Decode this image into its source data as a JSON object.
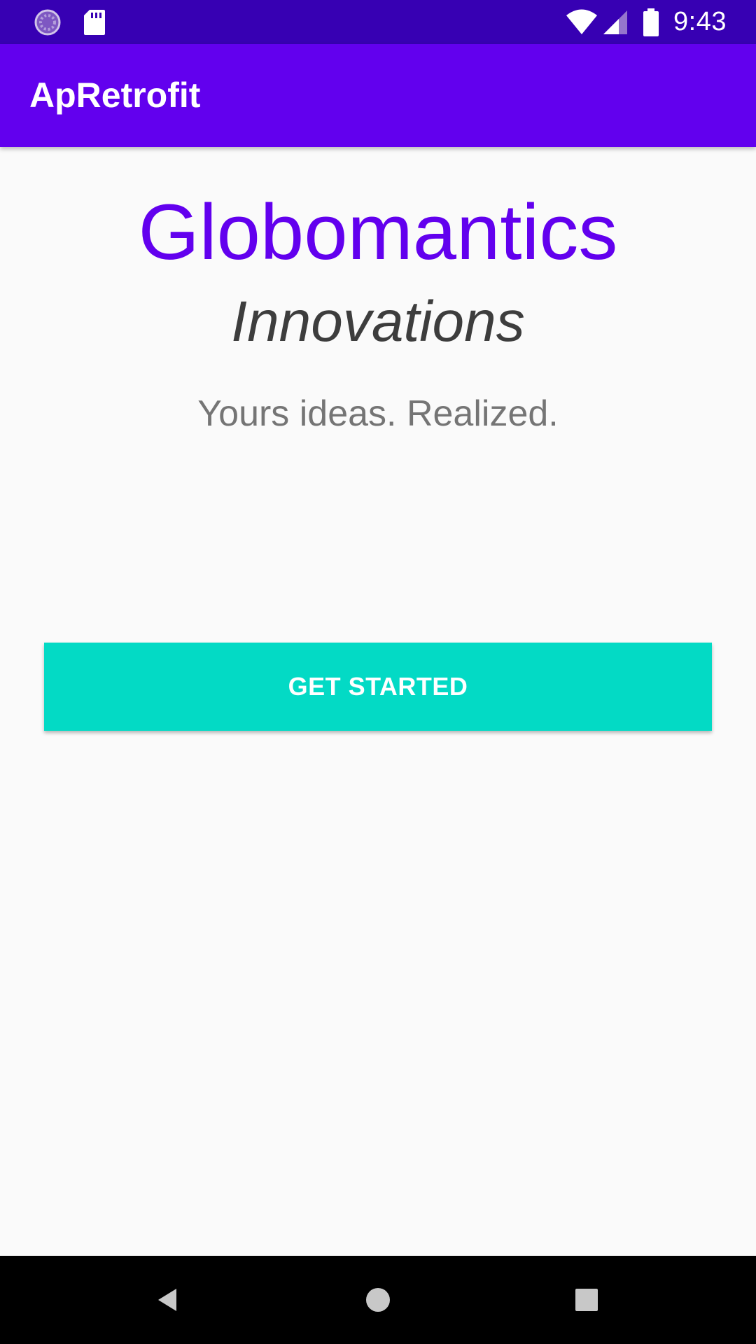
{
  "status_bar": {
    "time": "9:43",
    "icons": [
      "sync-icon",
      "sd-card-icon",
      "wifi-icon",
      "cellular-signal-icon",
      "battery-icon"
    ],
    "background": "#3700b3"
  },
  "app_bar": {
    "title": "ApRetrofit",
    "background": "#6200ee"
  },
  "main": {
    "brand": "Globomantics",
    "subtitle": "Innovations",
    "tagline": "Yours ideas. Realized.",
    "get_started_label": "GET STARTED"
  },
  "nav_bar": {
    "icons": [
      "back-icon",
      "home-icon",
      "recents-icon"
    ]
  },
  "colors": {
    "primary": "#6200ee",
    "primary_dark": "#3700b3",
    "accent": "#03dac5",
    "background": "#fafafa"
  }
}
